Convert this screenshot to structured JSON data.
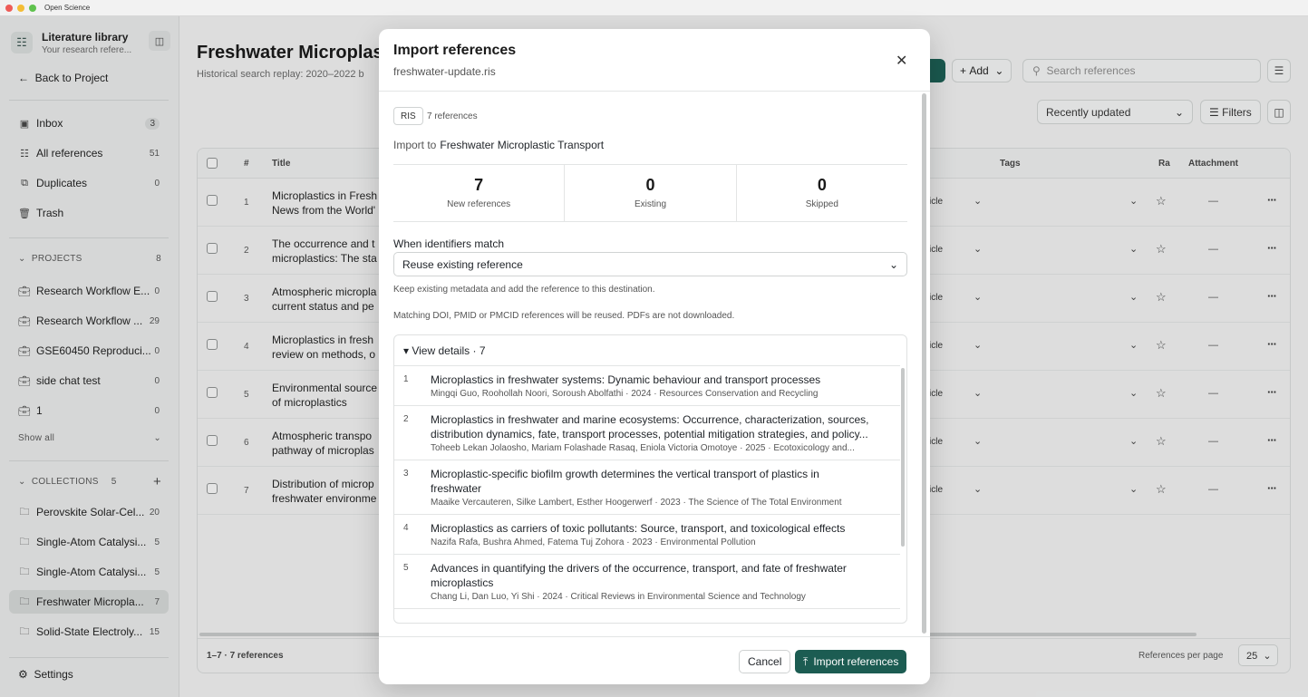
{
  "window": {
    "title": "Open Science"
  },
  "sidebar": {
    "library_title": "Literature library",
    "library_subtitle": "Your research refere...",
    "back_label": "Back to Project",
    "nav": [
      {
        "label": "Inbox",
        "count": "3",
        "icon": "inbox-icon"
      },
      {
        "label": "All references",
        "count": "51",
        "icon": "book-icon"
      },
      {
        "label": "Duplicates",
        "count": "0",
        "icon": "copy-icon"
      },
      {
        "label": "Trash",
        "count": "",
        "icon": "trash-icon"
      }
    ],
    "projects_header": "PROJECTS",
    "projects_count": "8",
    "projects": [
      {
        "label": "Research Workflow E...",
        "count": "0"
      },
      {
        "label": "Research Workflow ...",
        "count": "29"
      },
      {
        "label": "GSE60450 Reproduci...",
        "count": "0"
      },
      {
        "label": "side chat test",
        "count": "0"
      },
      {
        "label": "1",
        "count": "0"
      }
    ],
    "show_all": "Show all",
    "collections_header": "COLLECTIONS",
    "collections_count": "5",
    "collections": [
      {
        "label": "Perovskite Solar-Cel...",
        "count": "20"
      },
      {
        "label": "Single-Atom Catalysi...",
        "count": "5"
      },
      {
        "label": "Single-Atom Catalysi...",
        "count": "5"
      },
      {
        "label": "Freshwater Micropla...",
        "count": "7"
      },
      {
        "label": "Solid-State Electroly...",
        "count": "15"
      }
    ],
    "settings_label": "Settings"
  },
  "main": {
    "title": "Freshwater Microplastic",
    "subtitle": "Historical search replay: 2020–2022 b",
    "add_label": "Add",
    "search_placeholder": "Search references",
    "sort_label": "Recently updated",
    "filters_label": "Filters",
    "columns": {
      "number": "#",
      "title": "Title",
      "tags": "Tags",
      "rating": "Ra",
      "attachment": "Attachment"
    },
    "rows": [
      {
        "num": "1",
        "title_1": "Microplastics in Fresh",
        "title_2": "News from the World'",
        "type": "icle",
        "attachment": "—"
      },
      {
        "num": "2",
        "title_1": "The occurrence and t",
        "title_2": "microplastics: The sta",
        "type": "icle",
        "attachment": "—"
      },
      {
        "num": "3",
        "title_1": "Atmospheric micropla",
        "title_2": "current status and pe",
        "type": "icle",
        "attachment": "—"
      },
      {
        "num": "4",
        "title_1": "Microplastics in fresh",
        "title_2": "review on methods, o",
        "type": "icle",
        "attachment": "—"
      },
      {
        "num": "5",
        "title_1": "Environmental source",
        "title_2": "of microplastics",
        "type": "icle",
        "attachment": "—"
      },
      {
        "num": "6",
        "title_1": "Atmospheric transpo",
        "title_2": "pathway of microplas",
        "type": "icle",
        "attachment": "—"
      },
      {
        "num": "7",
        "title_1": "Distribution of microp",
        "title_2": "freshwater environme",
        "type": "icle",
        "attachment": "—"
      }
    ],
    "footer_range": "1–7 · 7 references",
    "per_page_label": "References per page",
    "per_page_value": "25"
  },
  "modal": {
    "title": "Import references",
    "filename": "freshwater-update.ris",
    "format": "RIS",
    "format_count": "7 references",
    "import_to_label": "Import to",
    "import_to_value": "Freshwater Microplastic Transport",
    "stats": [
      {
        "value": "7",
        "label": "New references"
      },
      {
        "value": "0",
        "label": "Existing"
      },
      {
        "value": "0",
        "label": "Skipped"
      }
    ],
    "match_label": "When identifiers match",
    "match_value": "Reuse existing reference",
    "match_help": "Keep existing metadata and add the reference to this destination.",
    "note": "Matching DOI, PMID or PMCID references will be reused. PDFs are not downloaded.",
    "details_label": "▾ View details · 7",
    "items": [
      {
        "num": "1",
        "title_1": "Microplastics in freshwater systems: Dynamic behaviour and transport processes",
        "title_2": "",
        "meta": "Mingqi Guo, Roohollah Noori, Soroush Abolfathi · 2024 · Resources Conservation and Recycling"
      },
      {
        "num": "2",
        "title_1": "Microplastics in freshwater and marine ecosystems: Occurrence, characterization, sources,",
        "title_2": "distribution dynamics, fate, transport processes, potential mitigation strategies, and policy...",
        "meta": "Toheeb Lekan Jolaosho, Mariam Folashade Rasaq, Eniola Victoria Omotoye · 2025 · Ecotoxicology and..."
      },
      {
        "num": "3",
        "title_1": "Microplastic-specific biofilm growth determines the vertical transport of plastics in",
        "title_2": "freshwater",
        "meta": "Maaike Vercauteren, Silke Lambert, Esther Hoogerwerf · 2023 · The Science of The Total Environment"
      },
      {
        "num": "4",
        "title_1": "Microplastics as carriers of toxic pollutants: Source, transport, and toxicological effects",
        "title_2": "",
        "meta": "Nazifa Rafa, Bushra Ahmed, Fatema Tuj Zohora · 2023 · Environmental Pollution"
      },
      {
        "num": "5",
        "title_1": "Advances in quantifying the drivers of the occurrence, transport, and fate of freshwater",
        "title_2": "microplastics",
        "meta": "Chang Li, Dan Luo, Yi Shi · 2024 · Critical Reviews in Environmental Science and Technology"
      }
    ],
    "cancel_label": "Cancel",
    "import_label": "Import references"
  },
  "colors": {
    "accent": "#1c5c52"
  }
}
